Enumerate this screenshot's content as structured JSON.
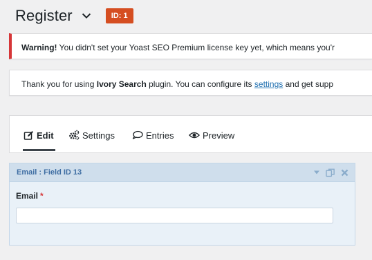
{
  "header": {
    "title": "Register",
    "id_badge": "ID: 1"
  },
  "notices": {
    "warning": {
      "strong": "Warning!",
      "text": " You didn't set your Yoast SEO Premium license key yet, which means you'r"
    },
    "info": {
      "text_before": "Thank you for using ",
      "strong": "Ivory Search",
      "text_middle": " plugin. You can configure its ",
      "link": "settings",
      "text_after": " and get supp"
    }
  },
  "tabs": {
    "edit": "Edit",
    "settings": "Settings",
    "entries": "Entries",
    "preview": "Preview"
  },
  "field": {
    "header_label": "Email : Field ID 13",
    "label": "Email",
    "required_mark": "*",
    "value": "",
    "placeholder": ""
  },
  "colors": {
    "badge": "#d54e21",
    "warning_border": "#d63638",
    "link": "#2271b1",
    "field_header": "#cfdeec",
    "field_body": "#e9f1f8",
    "field_header_text": "#3f6ea3"
  },
  "icons": {
    "title_dropdown": "chevron-down-icon",
    "edit": "edit-icon",
    "settings": "gears-icon",
    "entries": "speech-bubble-icon",
    "preview": "eye-icon",
    "collapse": "triangle-down-icon",
    "duplicate": "duplicate-icon",
    "delete": "close-icon"
  }
}
